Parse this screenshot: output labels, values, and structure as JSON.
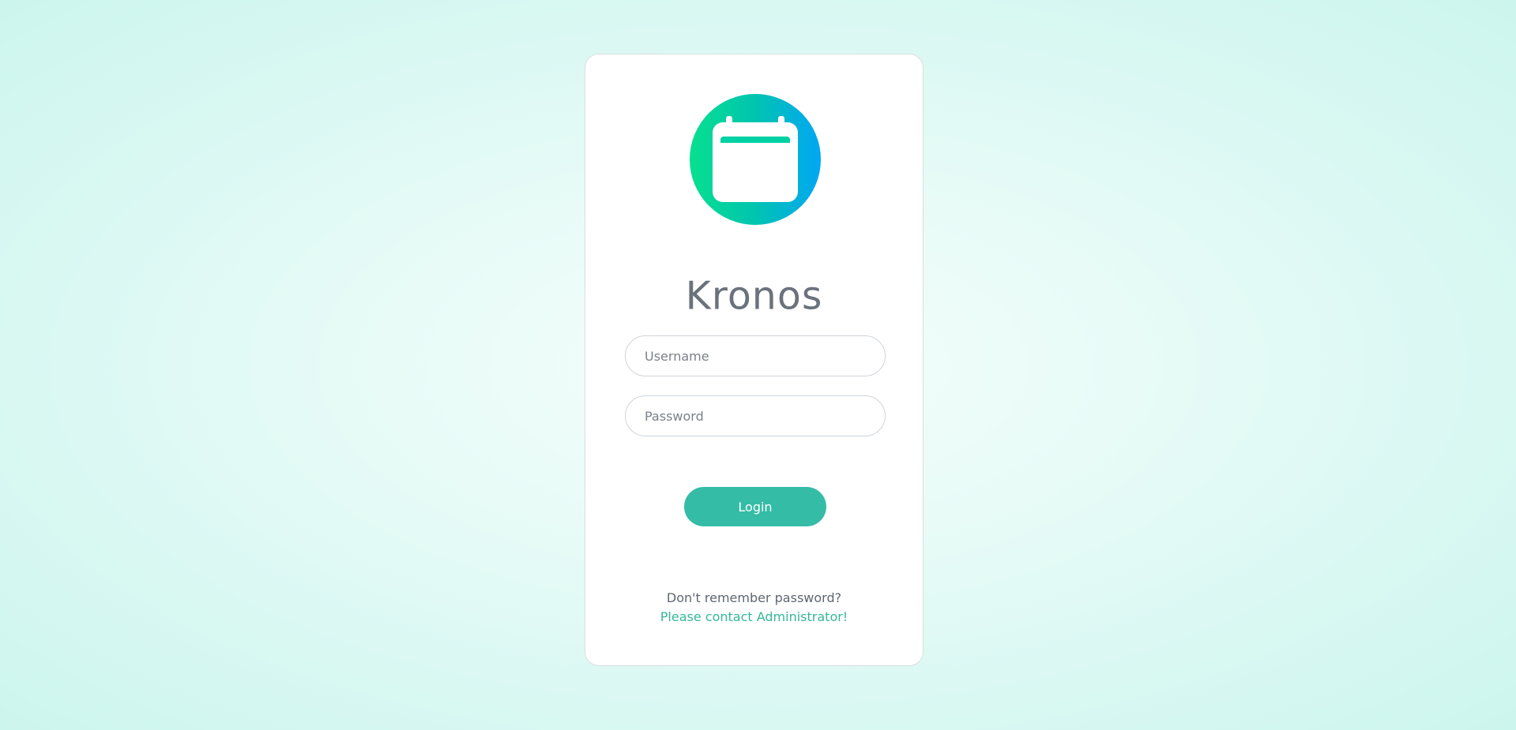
{
  "app": {
    "title": "Kronos",
    "logo_icon": "calendar-icon"
  },
  "login_form": {
    "username_placeholder": "Username",
    "password_placeholder": "Password",
    "username_value": "",
    "password_value": "",
    "login_label": "Login"
  },
  "help": {
    "question": "Don't remember password?",
    "contact_link": "Please contact Administrator!"
  },
  "colors": {
    "primary": "#35bca7",
    "link": "#36b79a",
    "title": "#6b727c",
    "logo_gradient_start": "#07e08f",
    "logo_gradient_end": "#02a6f4"
  }
}
